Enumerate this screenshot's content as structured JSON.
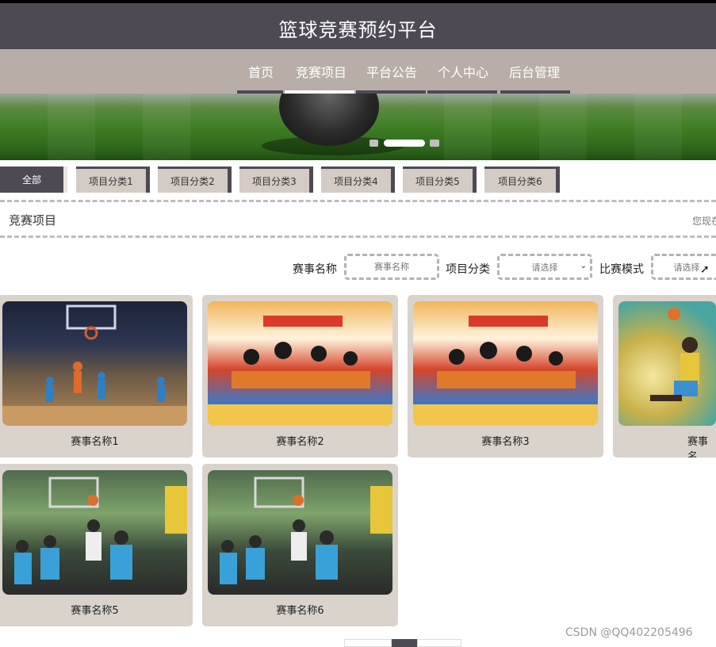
{
  "site": {
    "title": "篮球竞赛预约平台"
  },
  "nav": {
    "items": [
      {
        "label": "首页"
      },
      {
        "label": "竞赛项目"
      },
      {
        "label": "平台公告"
      },
      {
        "label": "个人中心"
      },
      {
        "label": "后台管理"
      }
    ],
    "active_index": 1
  },
  "banner": {
    "dots": 3,
    "active_dot": 1
  },
  "categories": [
    {
      "label": "全部"
    },
    {
      "label": "项目分类1"
    },
    {
      "label": "项目分类2"
    },
    {
      "label": "项目分类3"
    },
    {
      "label": "项目分类4"
    },
    {
      "label": "项目分类5"
    },
    {
      "label": "项目分类6"
    }
  ],
  "section": {
    "title": "竞赛项目",
    "right_text": "您现在"
  },
  "filters": {
    "name_label": "赛事名称",
    "name_placeholder": "赛事名称",
    "category_label": "项目分类",
    "category_value": "请选择",
    "mode_label": "比赛模式",
    "mode_value": "请选择"
  },
  "cards": [
    {
      "name": "赛事名称1",
      "image": "indoor-court"
    },
    {
      "name": "赛事名称2",
      "image": "recruit-poster"
    },
    {
      "name": "赛事名称3",
      "image": "recruit-poster"
    },
    {
      "name": "赛事名",
      "image": "dunk-illustration"
    },
    {
      "name": "赛事名称5",
      "image": "outdoor-game"
    },
    {
      "name": "赛事名称6",
      "image": "outdoor-game"
    }
  ],
  "pager": {
    "active_page": 2
  },
  "watermark": "CSDN @QQ402205496"
}
